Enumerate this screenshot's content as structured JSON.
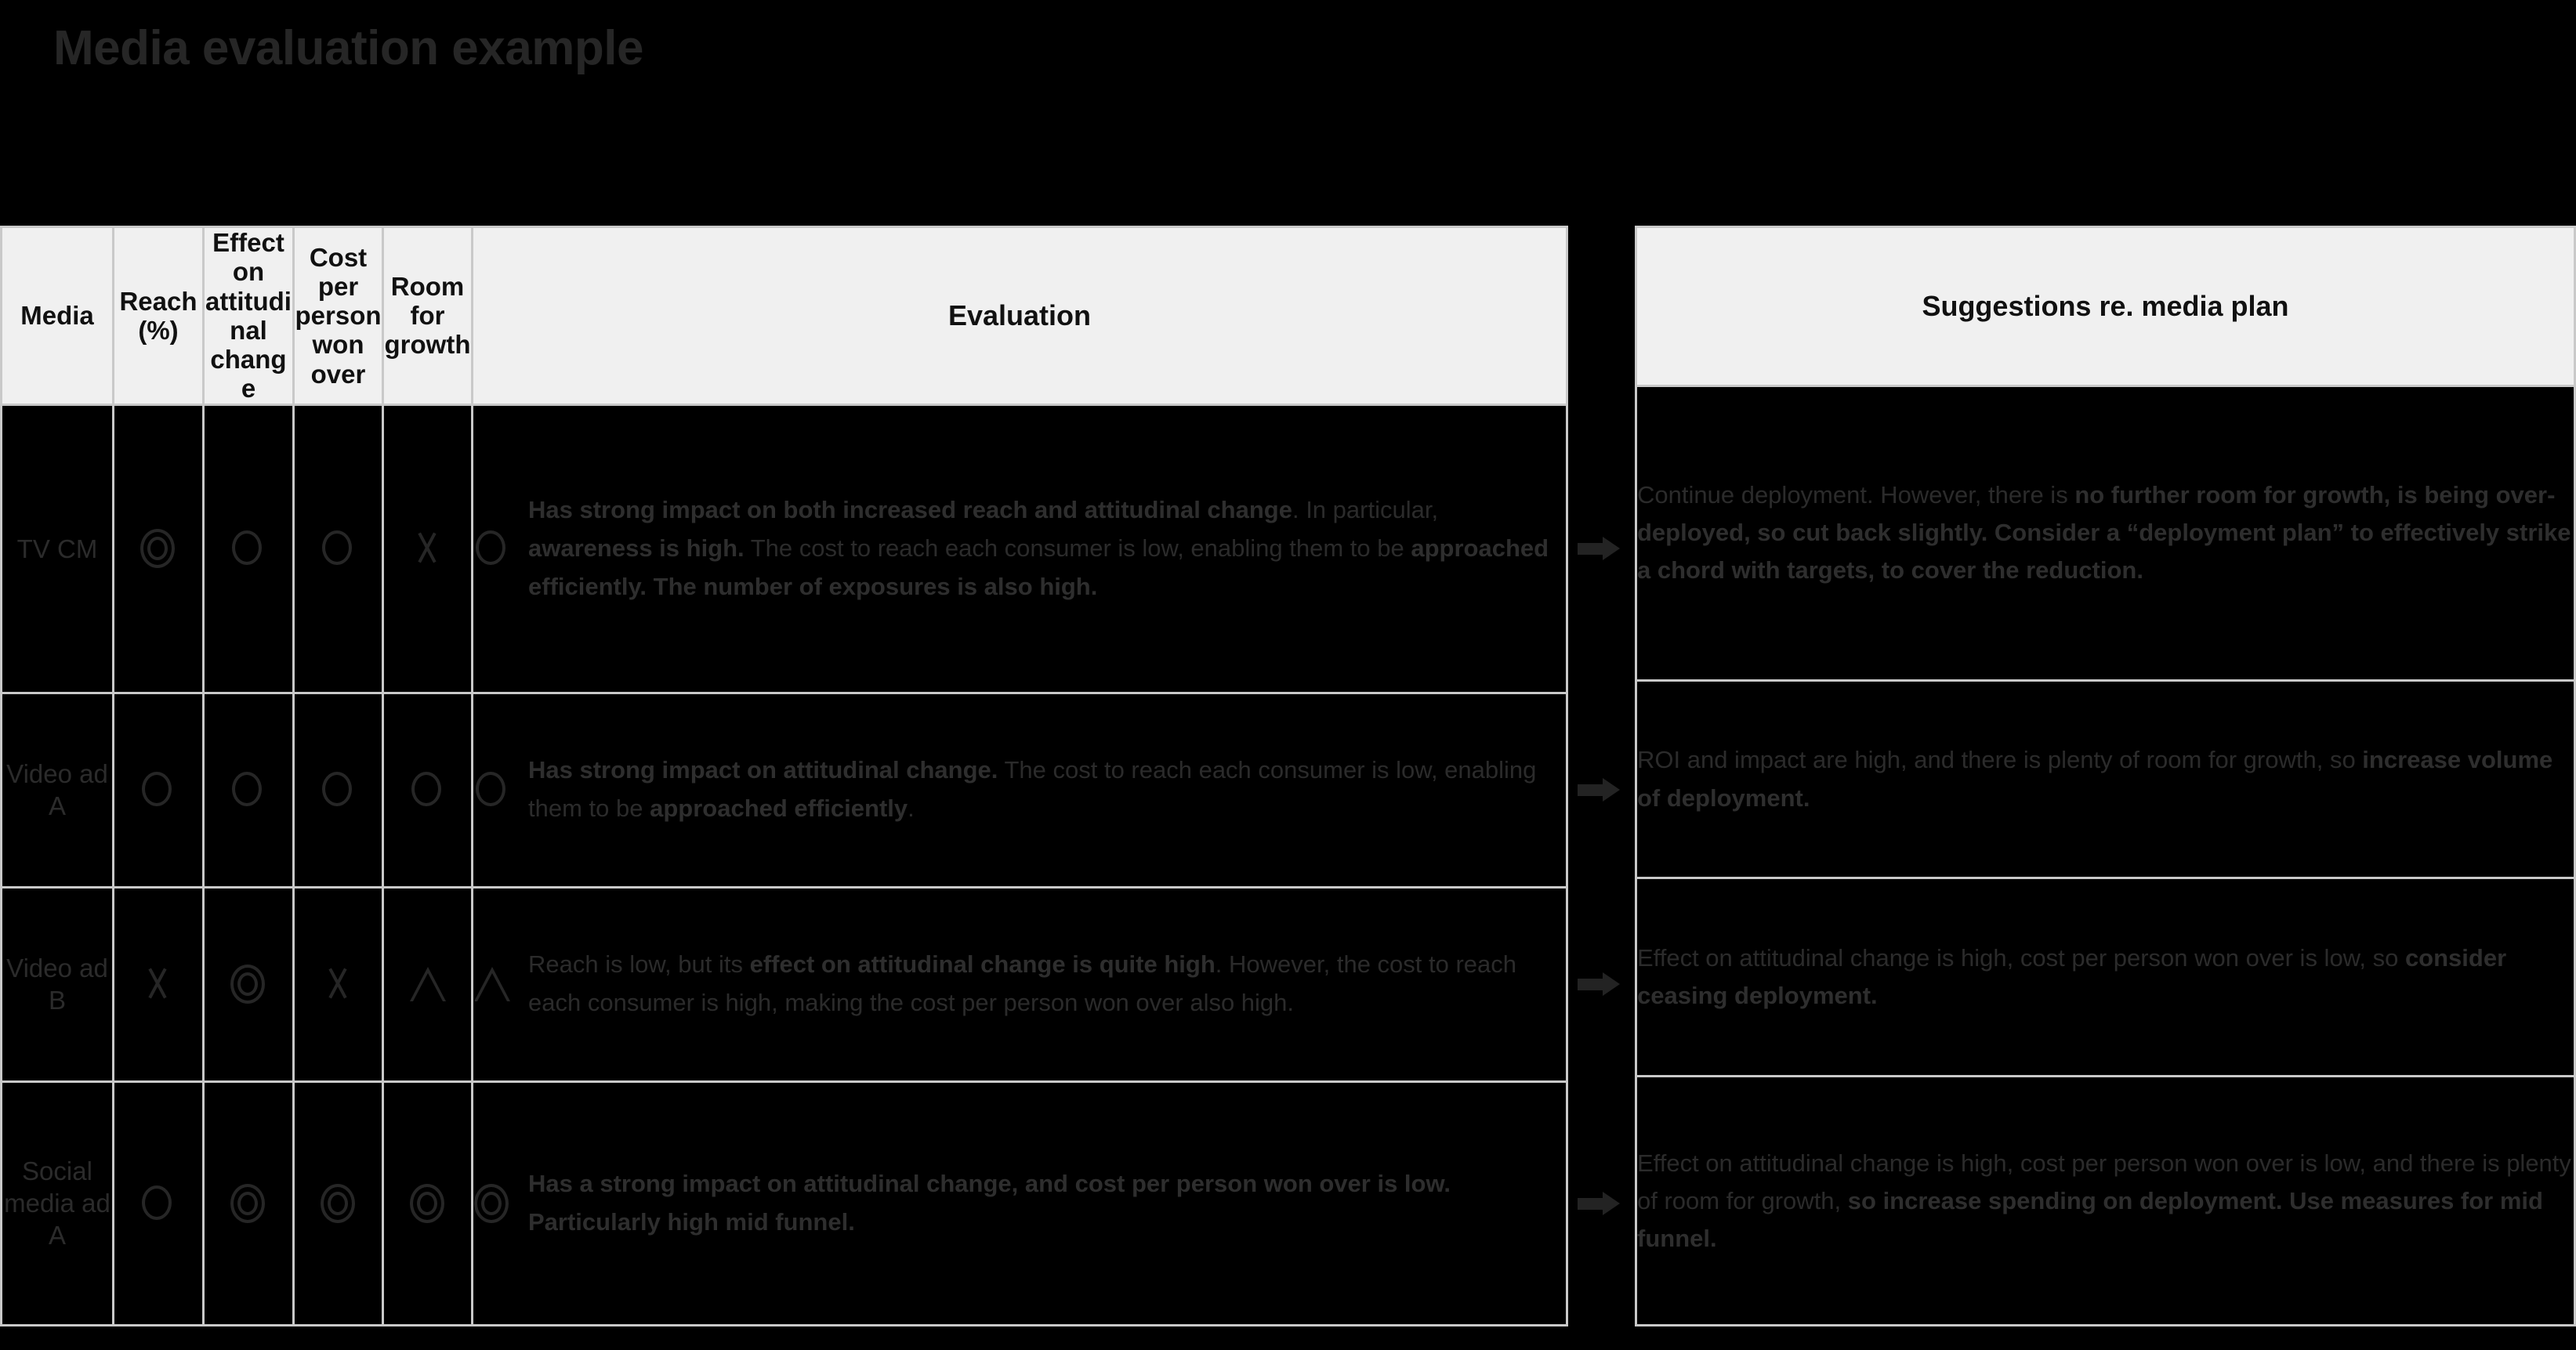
{
  "title": "Media evaluation example",
  "eval_table": {
    "headers": [
      "Media",
      "Reach (%)",
      "Effect on attitudinal change",
      "Cost per person won over",
      "Room for growth",
      "Evaluation"
    ],
    "rows": [
      {
        "media": "TV CM",
        "reach": "double-circle",
        "attitudinal": "circle",
        "cost": "circle",
        "growth": "cross",
        "overall": "circle",
        "evaluation_segments": [
          {
            "text": "Has strong impact on both increased reach and attitudinal change",
            "bold": true
          },
          {
            "text": ". In particular, ",
            "bold": false
          },
          {
            "text": "awareness is high.",
            "bold": true
          },
          {
            "text": "  The cost to reach each consumer is low, enabling them to be ",
            "bold": false
          },
          {
            "text": "approached efficiently. The number of exposures is also high.",
            "bold": true
          }
        ]
      },
      {
        "media": "Video ad A",
        "reach": "circle",
        "attitudinal": "circle",
        "cost": "circle",
        "growth": "circle",
        "overall": "circle",
        "evaluation_segments": [
          {
            "text": "Has strong impact on attitudinal change.",
            "bold": true
          },
          {
            "text": " The cost to reach each consumer is low, enabling them to be ",
            "bold": false
          },
          {
            "text": "approached efficiently",
            "bold": true
          },
          {
            "text": ".",
            "bold": false
          }
        ]
      },
      {
        "media": "Video ad B",
        "reach": "cross",
        "attitudinal": "double-circle",
        "cost": "cross",
        "growth": "triangle",
        "overall": "triangle",
        "evaluation_segments": [
          {
            "text": "Reach is low, but its ",
            "bold": false
          },
          {
            "text": "effect on attitudinal change is quite high",
            "bold": true
          },
          {
            "text": ". However, the cost to reach each consumer is high, making the cost per person won over also high.",
            "bold": false
          }
        ]
      },
      {
        "media": "Social media ad A",
        "reach": "circle",
        "attitudinal": "double-circle",
        "cost": "double-circle",
        "growth": "double-circle",
        "overall": "double-circle",
        "evaluation_segments": [
          {
            "text": "Has a strong impact on attitudinal change, and cost per person won over is low.",
            "bold": true
          },
          {
            "text": "\n",
            "bold": false
          },
          {
            "text": "Particularly high mid funnel.",
            "bold": true
          }
        ]
      }
    ]
  },
  "suggestions_panel": {
    "header": "Suggestions re. media plan",
    "rows": [
      {
        "segments": [
          {
            "text": "Continue deployment. However, there is ",
            "bold": false
          },
          {
            "text": "no further room for growth, is being over-deployed, so cut back slightly. Consider a “deployment plan” to effectively strike a chord with targets, to cover the reduction.",
            "bold": true
          }
        ]
      },
      {
        "segments": [
          {
            "text": "ROI and impact are high, and there is plenty of room for growth, so ",
            "bold": false
          },
          {
            "text": "increase volume of deployment.",
            "bold": true
          }
        ]
      },
      {
        "segments": [
          {
            "text": "Effect on attitudinal change is high, cost per person won over is low, so ",
            "bold": false
          },
          {
            "text": "consider ceasing deployment.",
            "bold": true
          }
        ]
      },
      {
        "segments": [
          {
            "text": "Effect on attitudinal change is high, cost per person won over is low, and there is plenty of room for growth, ",
            "bold": false
          },
          {
            "text": "so increase spending on deployment. Use measures for mid funnel.",
            "bold": true
          }
        ]
      }
    ]
  },
  "connectors": {
    "icon": "arrow-right-icon",
    "count": 4
  },
  "colors": {
    "background": "#000000",
    "header_fill": "#f0f0f0",
    "grid_line": "#c9c9c9",
    "body_text": "#2b2b2b",
    "title_text": "#262626"
  }
}
